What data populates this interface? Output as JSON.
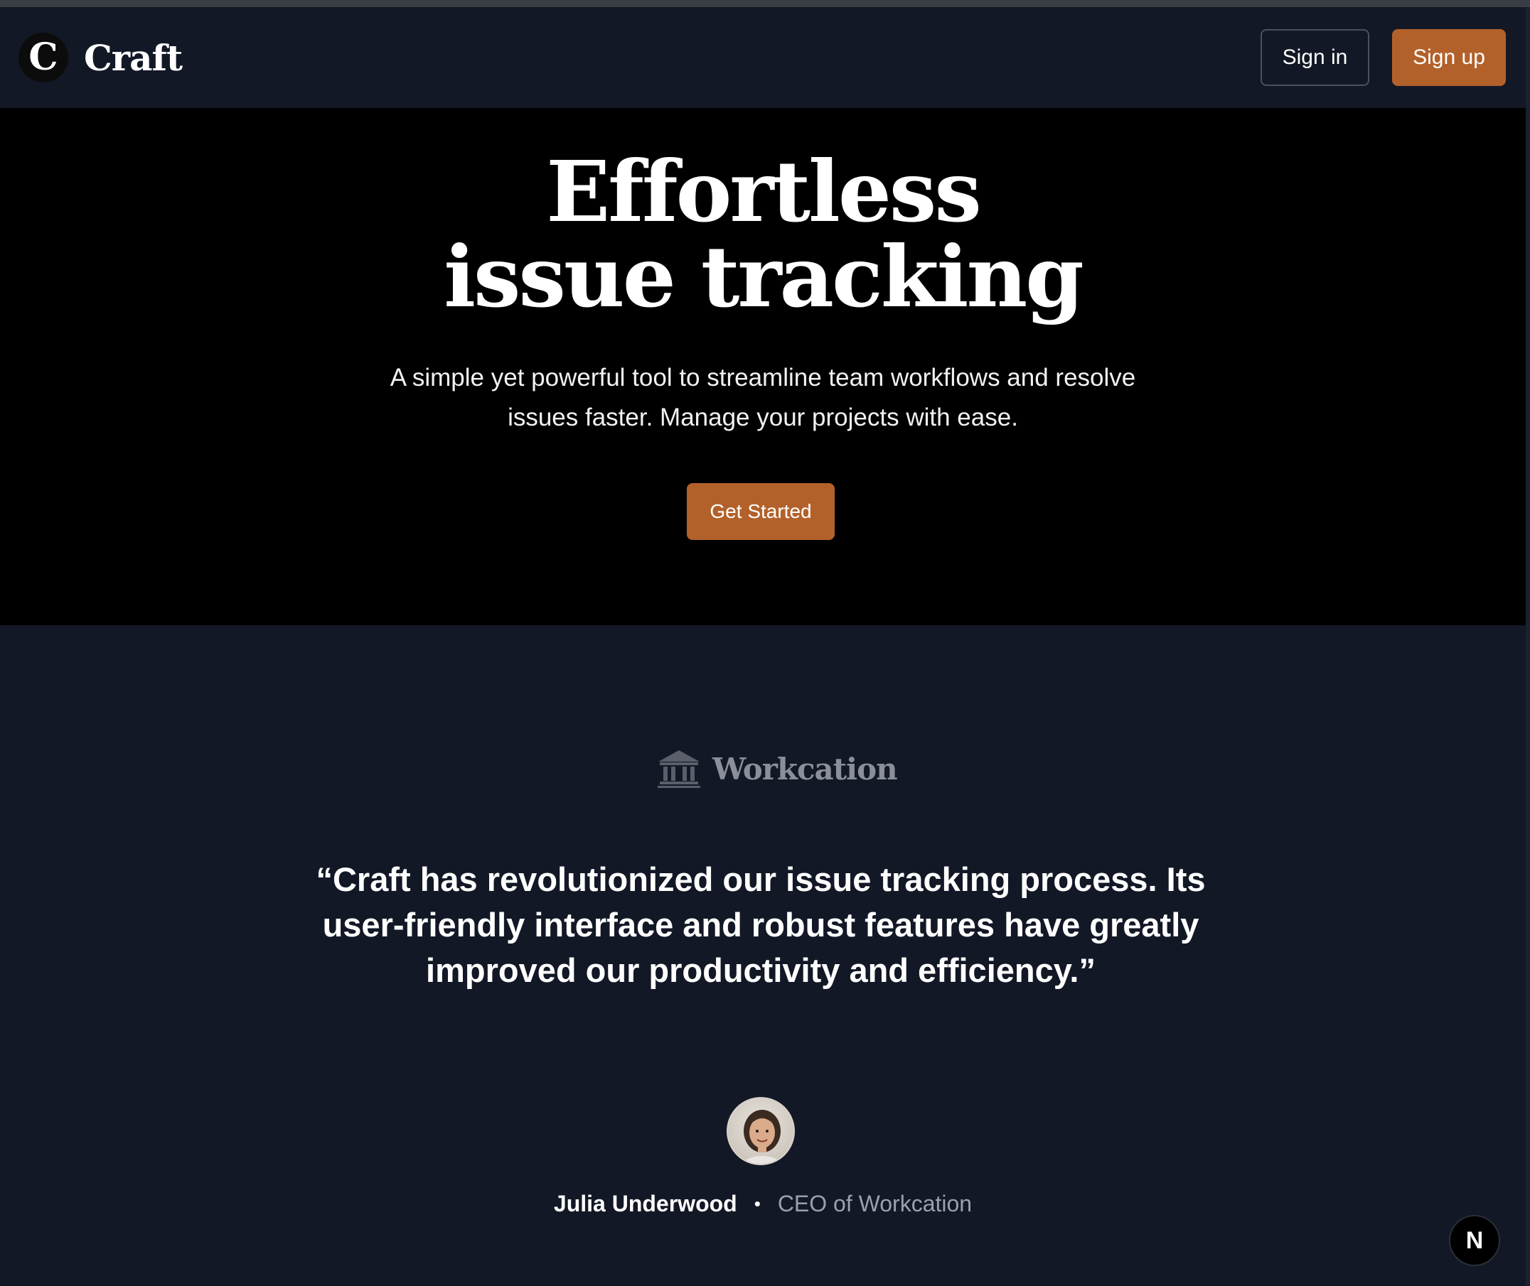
{
  "header": {
    "logo_letter": "C",
    "brand_name": "Craft",
    "signin_label": "Sign in",
    "signup_label": "Sign up"
  },
  "hero": {
    "title_line1": "Effortless",
    "title_line2": "issue tracking",
    "subtitle_line1": "A simple yet powerful tool to streamline team workflows and resolve",
    "subtitle_line2": "issues faster. Manage your projects with ease.",
    "cta_label": "Get Started"
  },
  "testimonial": {
    "company_icon": "bank-icon",
    "company_name": "Workcation",
    "quote": "“Craft has revolutionized our issue tracking process. Its user-friendly interface and robust features have greatly improved our productivity and efficiency.”",
    "author_name": "Julia Underwood",
    "separator": "•",
    "author_role": "CEO of Workcation"
  },
  "floating_badge": "N",
  "colors": {
    "accent": "#b3612a",
    "page_bg": "#131826",
    "hero_bg": "#000000",
    "muted_text": "#9aa0ad"
  }
}
